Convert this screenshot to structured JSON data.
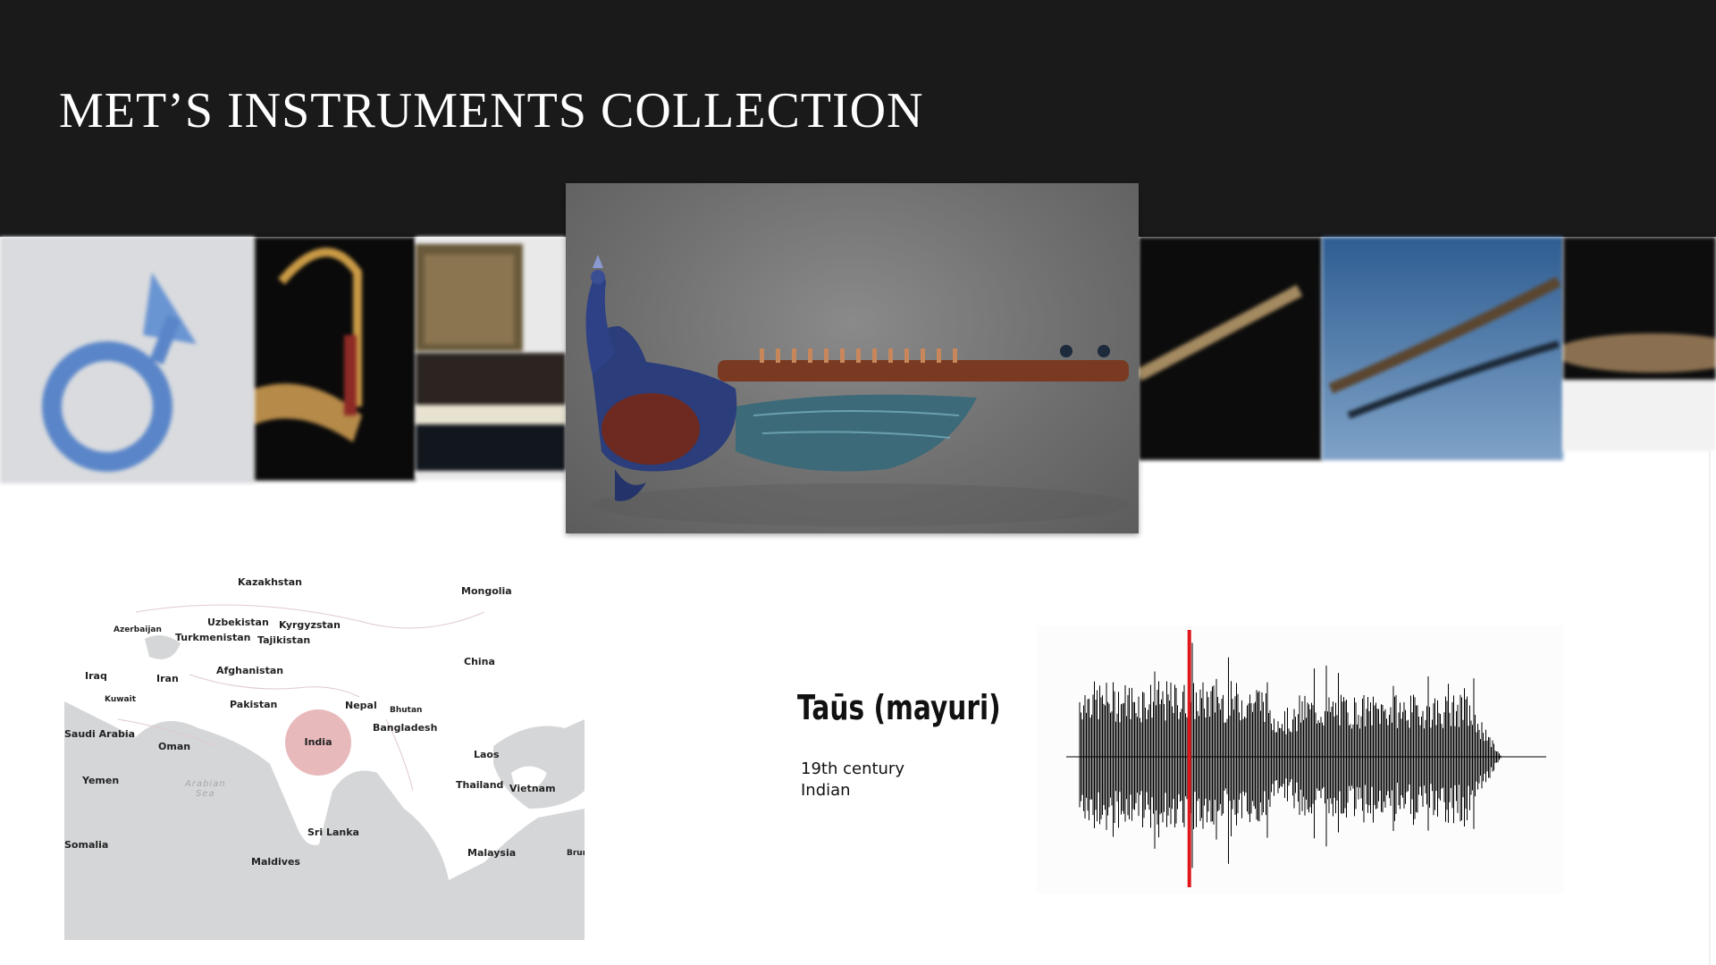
{
  "page": {
    "title": "MET’S INSTRUMENTS COLLECTION"
  },
  "carousel": {
    "thumbnails": [
      {
        "name": "blue-horn"
      },
      {
        "name": "golden-harp"
      },
      {
        "name": "virginal"
      },
      {
        "name": "wooden-flute"
      },
      {
        "name": "stringed-instrument"
      },
      {
        "name": "brass-instrument"
      }
    ]
  },
  "featured": {
    "name": "taus-peacock-instrument"
  },
  "instrument": {
    "name": "Taūs (mayuri)",
    "period": "19th century",
    "origin": "Indian"
  },
  "map": {
    "highlight_country": "India",
    "labels": [
      "Kazakhstan",
      "Mongolia",
      "Uzbekistan",
      "Kyrgyzstan",
      "Azerbaijan",
      "Turkmenistan",
      "Tajikistan",
      "China",
      "Afghanistan",
      "Iraq",
      "Iran",
      "Kuwait",
      "Pakistan",
      "Nepal",
      "Bhutan",
      "Saudi Arabia",
      "Bangladesh",
      "Oman",
      "Laos",
      "Yemen",
      "Thailand",
      "Vietnam",
      "Sri Lanka",
      "Somalia",
      "Malaysia",
      "Maldives",
      "Brun",
      "Arabian Sea"
    ]
  },
  "waveform": {
    "playhead_fraction": 0.26
  },
  "colors": {
    "header_bg": "#1a1a1a",
    "marker": "#d68084",
    "playhead": "#e0161b"
  }
}
